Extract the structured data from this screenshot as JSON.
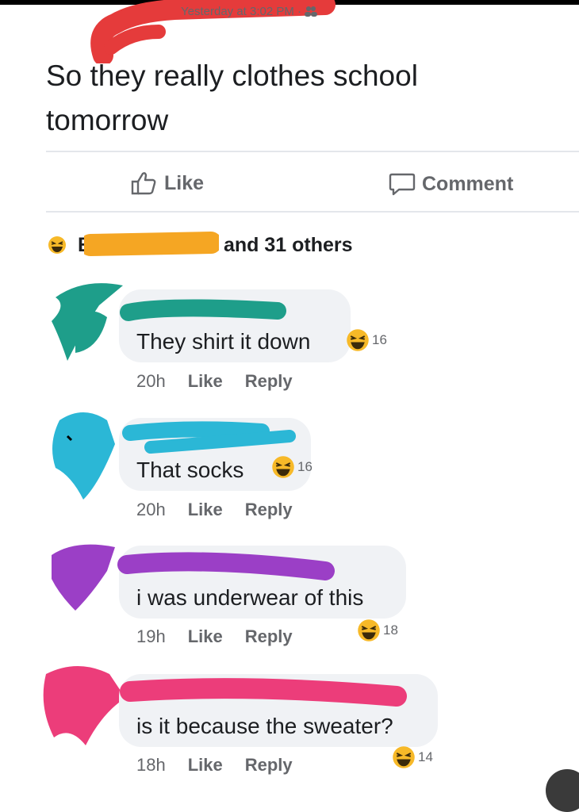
{
  "header": {
    "timestamp": "Yesterday at 3:02 PM · "
  },
  "post": {
    "text": "So they really clothes school tomorrow"
  },
  "actions": {
    "like": "Like",
    "comment": "Comment"
  },
  "reactions": {
    "summary": "and 31 others",
    "name_initial": "E"
  },
  "comments": [
    {
      "text": "They shirt it down",
      "time": "20h",
      "like": "Like",
      "reply": "Reply",
      "count": "16"
    },
    {
      "text": "That socks",
      "time": "20h",
      "like": "Like",
      "reply": "Reply",
      "count": "16"
    },
    {
      "text": "i was underwear of this",
      "time": "19h",
      "like": "Like",
      "reply": "Reply",
      "count": "18"
    },
    {
      "text": "is it because the sweater?",
      "time": "18h",
      "like": "Like",
      "reply": "Reply",
      "count": "14"
    }
  ],
  "colors": {
    "redact_header": "#e53b3b",
    "redact_reactor": "#f5a623",
    "redact_c1": "#1e9e8a",
    "redact_c2": "#2bb7d6",
    "redact_c3": "#9b3fc6",
    "redact_c4": "#ec3d7a"
  },
  "icons": [
    "like-icon",
    "comment-icon",
    "haha-reaction-icon",
    "audience-friends-icon"
  ]
}
